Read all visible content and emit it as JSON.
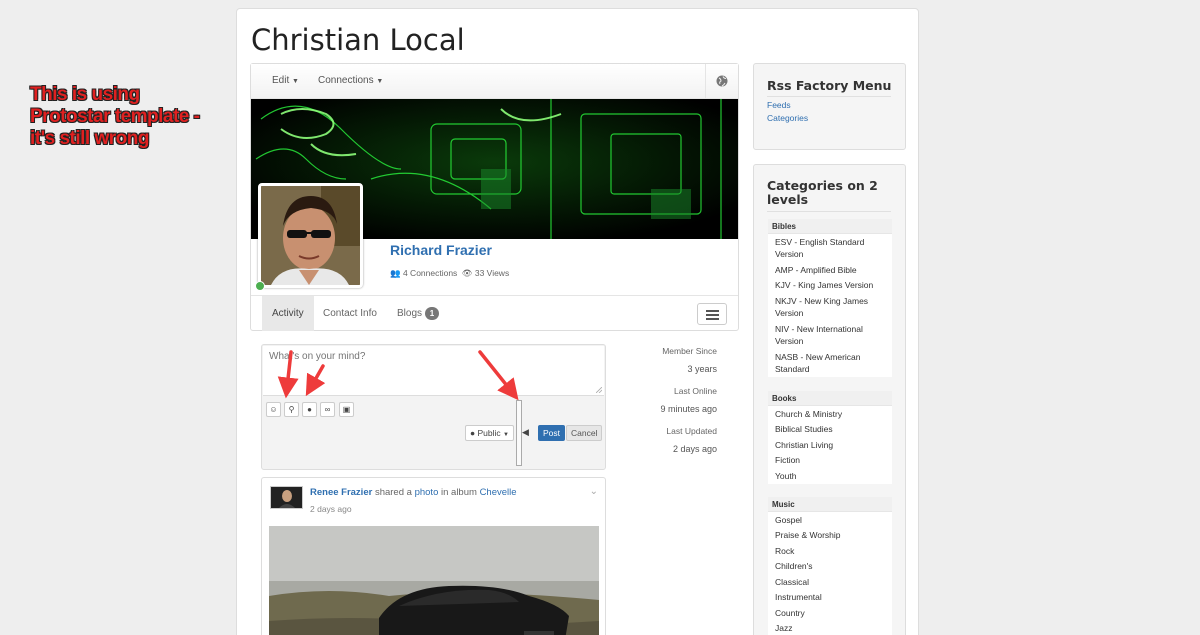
{
  "annotation": {
    "lines": [
      "This is using",
      "Protostar template -",
      "it's still wrong"
    ],
    "color": "#e02020"
  },
  "site": {
    "title": "Christian Local"
  },
  "profile": {
    "toolbar": {
      "edit_label": "Edit",
      "connections_label": "Connections",
      "globe_icon": "globe-icon"
    },
    "name": "Richard Frazier",
    "connections": "4 Connections",
    "views": "33 Views",
    "online": true,
    "tabs": [
      {
        "label": "Activity",
        "active": true
      },
      {
        "label": "Contact Info",
        "active": false
      },
      {
        "label": "Blogs",
        "badge": "1",
        "active": false
      }
    ]
  },
  "composer": {
    "placeholder": "What's on your mind?",
    "tools": [
      "smiley-icon",
      "map-marker-icon",
      "user-icon",
      "link-icon",
      "image-icon"
    ],
    "privacy_label": "Public",
    "post_label": "Post",
    "cancel_label": "Cancel"
  },
  "info": [
    {
      "label": "Member Since",
      "value": "3 years"
    },
    {
      "label": "Last Online",
      "value": "9 minutes ago"
    },
    {
      "label": "Last Updated",
      "value": "2 days ago"
    }
  ],
  "feed": {
    "author": "Renee Frazier",
    "action": "shared a",
    "object": "photo",
    "in_text": "in album",
    "album": "Chevelle",
    "time": "2 days ago"
  },
  "sidebar": {
    "rss_menu": {
      "title": "Rss Factory Menu",
      "links": [
        "Feeds",
        "Categories"
      ]
    },
    "categories": {
      "title": "Categories on 2 levels",
      "groups": [
        {
          "name": "Bibles",
          "items": [
            "ESV - English Standard Version",
            "AMP - Amplified Bible",
            "KJV - King James Version",
            "NKJV - New King James Version",
            "NIV - New International Version",
            "NASB - New American Standard"
          ]
        },
        {
          "name": "Books",
          "items": [
            "Church & Ministry",
            "Biblical Studies",
            "Christian Living",
            "Fiction",
            "Youth"
          ]
        },
        {
          "name": "Music",
          "items": [
            "Gospel",
            "Praise & Worship",
            "Rock",
            "Children's",
            "Classical",
            "Instrumental",
            "Country",
            "Jazz"
          ]
        }
      ]
    }
  },
  "colors": {
    "link": "#2f6fb0",
    "post_button": "#2f6fb0",
    "online_dot": "#4caf50",
    "arrow": "#ee3b3b"
  }
}
